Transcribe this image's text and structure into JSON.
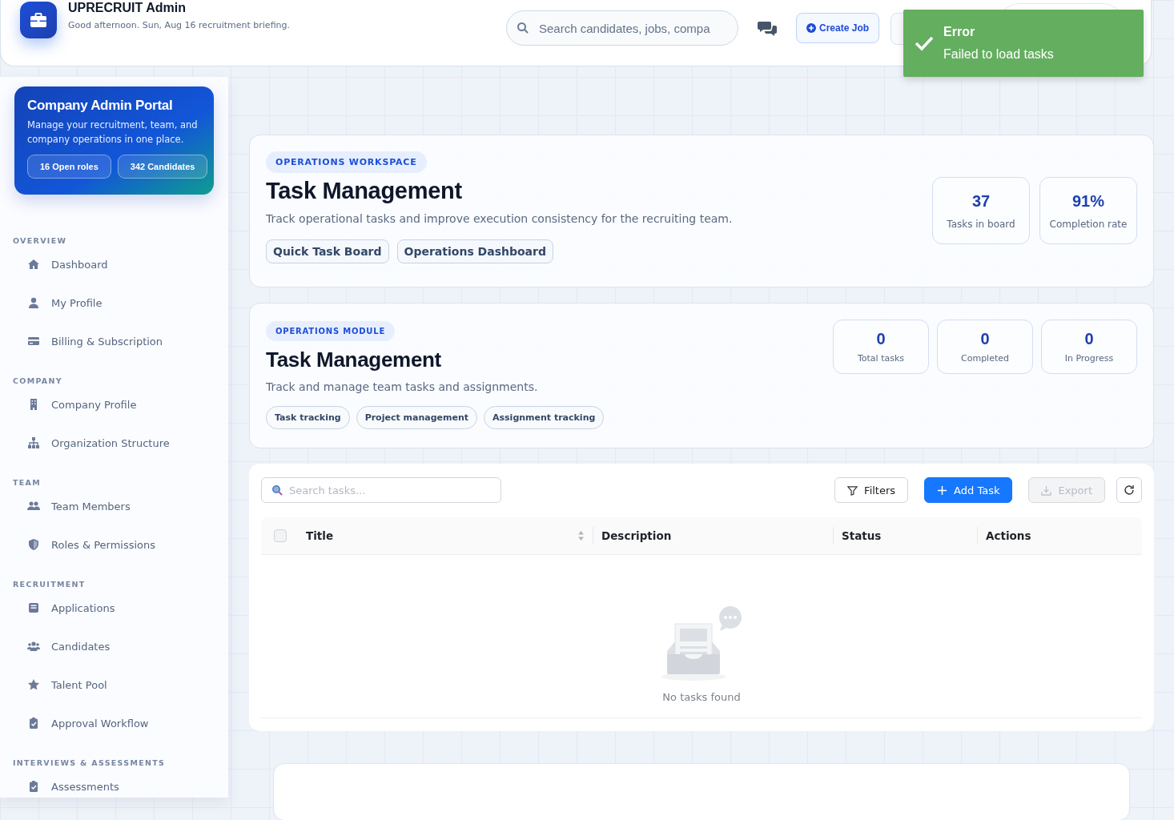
{
  "header": {
    "title": "UPRECRUIT Admin",
    "subtitle": "Good afternoon. Sun, Aug 16 recruitment briefing.",
    "search": {
      "placeholder": "Search candidates, jobs, compa"
    },
    "create_button": "Create Job"
  },
  "toast": {
    "title": "Error",
    "message": "Failed to load tasks"
  },
  "sidebar": {
    "portal": {
      "title": "Company Admin Portal",
      "description": "Manage your recruitment, team, and company operations in one place.",
      "badges": [
        "16 Open roles",
        "342 Candidates"
      ]
    },
    "sections": [
      {
        "label": "OVERVIEW",
        "items": [
          {
            "label": "Dashboard",
            "selected": false
          },
          {
            "label": "My Profile",
            "selected": false
          },
          {
            "label": "Billing & Subscription",
            "selected": false
          }
        ]
      },
      {
        "label": "COMPANY",
        "items": [
          {
            "label": "Company Profile",
            "selected": false
          },
          {
            "label": "Organization Structure",
            "selected": false
          }
        ]
      },
      {
        "label": "TEAM",
        "items": [
          {
            "label": "Team Members",
            "selected": false
          },
          {
            "label": "Roles & Permissions",
            "selected": false
          }
        ]
      },
      {
        "label": "RECRUITMENT",
        "items": [
          {
            "label": "Applications",
            "selected": false
          },
          {
            "label": "Candidates",
            "selected": false
          },
          {
            "label": "Talent Pool",
            "selected": false
          },
          {
            "label": "Approval Workflow",
            "selected": false
          }
        ]
      },
      {
        "label": "INTERVIEWS & ASSESSMENTS",
        "items": [
          {
            "label": "Assessments",
            "selected": false
          }
        ]
      }
    ]
  },
  "workspace": {
    "badge": "OPERATIONS WORKSPACE",
    "title": "Task Management",
    "description": "Track operational tasks and improve execution consistency for the recruiting team.",
    "links": [
      "Quick Task Board",
      "Operations Dashboard"
    ],
    "stats": [
      {
        "value": "37",
        "label": "Tasks in board"
      },
      {
        "value": "91%",
        "label": "Completion rate"
      }
    ]
  },
  "module": {
    "badge": "OPERATIONS MODULE",
    "title": "Task Management",
    "description": "Track and manage team tasks and assignments.",
    "tags": [
      "Task tracking",
      "Project management",
      "Assignment tracking"
    ],
    "stats": [
      {
        "value": "0",
        "label": "Total tasks"
      },
      {
        "value": "0",
        "label": "Completed"
      },
      {
        "value": "0",
        "label": "In Progress"
      }
    ]
  },
  "tasks": {
    "search": {
      "placeholder": "Search tasks..."
    },
    "filters_button": "Filters",
    "add_button": "Add Task",
    "export_button": {
      "label": "Export",
      "disabled": true
    },
    "select_all": {
      "checked": false
    },
    "columns": [
      "Title",
      "Description",
      "Status",
      "Actions"
    ],
    "empty_text": "No tasks found"
  }
}
